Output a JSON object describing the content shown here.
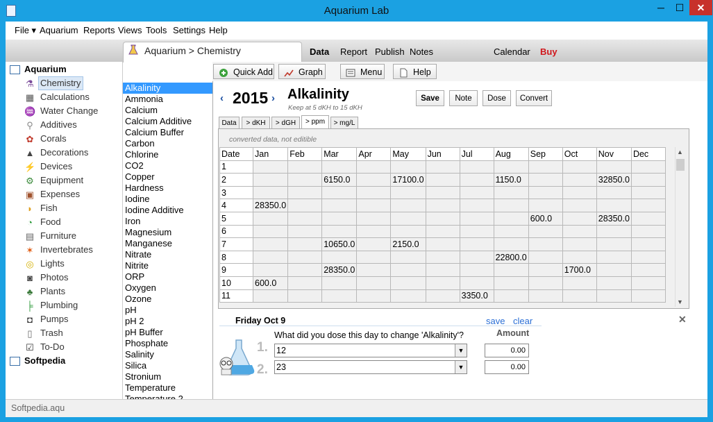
{
  "window": {
    "title": "Aquarium Lab",
    "min": "─",
    "max": "☐",
    "close": "✕"
  },
  "menu": [
    "File ▾",
    "Aquarium",
    "Reports",
    "Views",
    "Tools",
    "Settings",
    "Help"
  ],
  "breadcrumb": "Aquarium > Chemistry",
  "top_tabs": [
    "Data",
    "Report",
    "Publish",
    "Notes",
    "Calendar",
    "Buy"
  ],
  "toolbar": {
    "quick_add": "Quick Add",
    "graph": "Graph",
    "menu": "Menu",
    "help": "Help"
  },
  "sidebar": {
    "group1": "Aquarium",
    "group2": "Softpedia",
    "items": [
      {
        "label": "Chemistry",
        "icon": "flask-icon"
      },
      {
        "label": "Calculations",
        "icon": "calculator-icon"
      },
      {
        "label": "Water Change",
        "icon": "water-change-icon"
      },
      {
        "label": "Additives",
        "icon": "additives-icon"
      },
      {
        "label": "Corals",
        "icon": "coral-icon"
      },
      {
        "label": "Decorations",
        "icon": "decoration-icon"
      },
      {
        "label": "Devices",
        "icon": "device-icon"
      },
      {
        "label": "Equipment",
        "icon": "equipment-icon"
      },
      {
        "label": "Expenses",
        "icon": "expenses-icon"
      },
      {
        "label": "Fish",
        "icon": "fish-icon"
      },
      {
        "label": "Food",
        "icon": "food-icon"
      },
      {
        "label": "Furniture",
        "icon": "furniture-icon"
      },
      {
        "label": "Invertebrates",
        "icon": "starfish-icon"
      },
      {
        "label": "Lights",
        "icon": "bulb-icon"
      },
      {
        "label": "Photos",
        "icon": "camera-icon"
      },
      {
        "label": "Plants",
        "icon": "plant-icon"
      },
      {
        "label": "Plumbing",
        "icon": "pipe-icon"
      },
      {
        "label": "Pumps",
        "icon": "pump-icon"
      },
      {
        "label": "Trash",
        "icon": "trash-icon"
      },
      {
        "label": "To-Do",
        "icon": "clipboard-icon"
      }
    ]
  },
  "parameters": [
    "Alkalinity",
    "Ammonia",
    "Calcium",
    "Calcium Additive",
    "Calcium Buffer",
    "Carbon",
    "Chlorine",
    "CO2",
    "Copper",
    "Hardness",
    "Iodine",
    "Iodine Additive",
    "Iron",
    "Magnesium",
    "Manganese",
    "Nitrate",
    "Nitrite",
    "ORP",
    "Oxygen",
    "Ozone",
    "pH",
    "pH 2",
    "pH Buffer",
    "Phosphate",
    "Salinity",
    "Silica",
    "Stronium",
    "Temperature",
    "Temperature 2"
  ],
  "year": "2015",
  "nav": {
    "prev": "‹",
    "next": "›"
  },
  "param_title": "Alkalinity",
  "param_sub": "Keep at 5 dKH to 15 dKH",
  "actions": {
    "save": "Save",
    "note": "Note",
    "dose": "Dose",
    "convert": "Convert"
  },
  "unit_tabs": [
    "Data",
    "> dKH",
    "> dGH",
    "> ppm",
    "> mg/L"
  ],
  "converted_note": "converted data, not editible",
  "table": {
    "headers": [
      "Date",
      "Jan",
      "Feb",
      "Mar",
      "Apr",
      "May",
      "Jun",
      "Jul",
      "Aug",
      "Sep",
      "Oct",
      "Nov",
      "Dec"
    ],
    "rows": [
      [
        "1",
        "",
        "",
        "",
        "",
        "",
        "",
        "",
        "",
        "",
        "",
        "",
        ""
      ],
      [
        "2",
        "",
        "",
        "6150.0",
        "",
        "17100.0",
        "",
        "",
        "1150.0",
        "",
        "",
        "32850.0",
        ""
      ],
      [
        "3",
        "",
        "",
        "",
        "",
        "",
        "",
        "",
        "",
        "",
        "",
        "",
        ""
      ],
      [
        "4",
        "28350.0",
        "",
        "",
        "",
        "",
        "",
        "",
        "",
        "",
        "",
        "",
        ""
      ],
      [
        "5",
        "",
        "",
        "",
        "",
        "",
        "",
        "",
        "",
        "600.0",
        "",
        "28350.0",
        ""
      ],
      [
        "6",
        "",
        "",
        "",
        "",
        "",
        "",
        "",
        "",
        "",
        "",
        "",
        ""
      ],
      [
        "7",
        "",
        "",
        "10650.0",
        "",
        "2150.0",
        "",
        "",
        "",
        "",
        "",
        "",
        ""
      ],
      [
        "8",
        "",
        "",
        "",
        "",
        "",
        "",
        "",
        "22800.0",
        "",
        "",
        "",
        ""
      ],
      [
        "9",
        "",
        "",
        "28350.0",
        "",
        "",
        "",
        "",
        "",
        "",
        "1700.0",
        "",
        ""
      ],
      [
        "10",
        "600.0",
        "",
        "",
        "",
        "",
        "",
        "",
        "",
        "",
        "",
        "",
        ""
      ],
      [
        "11",
        "",
        "",
        "",
        "",
        "",
        "",
        "3350.0",
        "",
        "",
        "",
        "",
        ""
      ]
    ]
  },
  "dose": {
    "date": "Friday Oct 9",
    "save": "save",
    "clear": "clear",
    "question": "What did you dose this day to change 'Alkalinity'?",
    "amount_label": "Amount",
    "rows": [
      {
        "num": "1.",
        "value": "12",
        "amount": "0.00"
      },
      {
        "num": "2.",
        "value": "23",
        "amount": "0.00"
      }
    ]
  },
  "status": "Softpedia.aqu",
  "colors": {
    "titlebar": "#1ba1e2",
    "selection": "#3399ff",
    "buy": "#d0161b",
    "link": "#2b6fd6"
  }
}
